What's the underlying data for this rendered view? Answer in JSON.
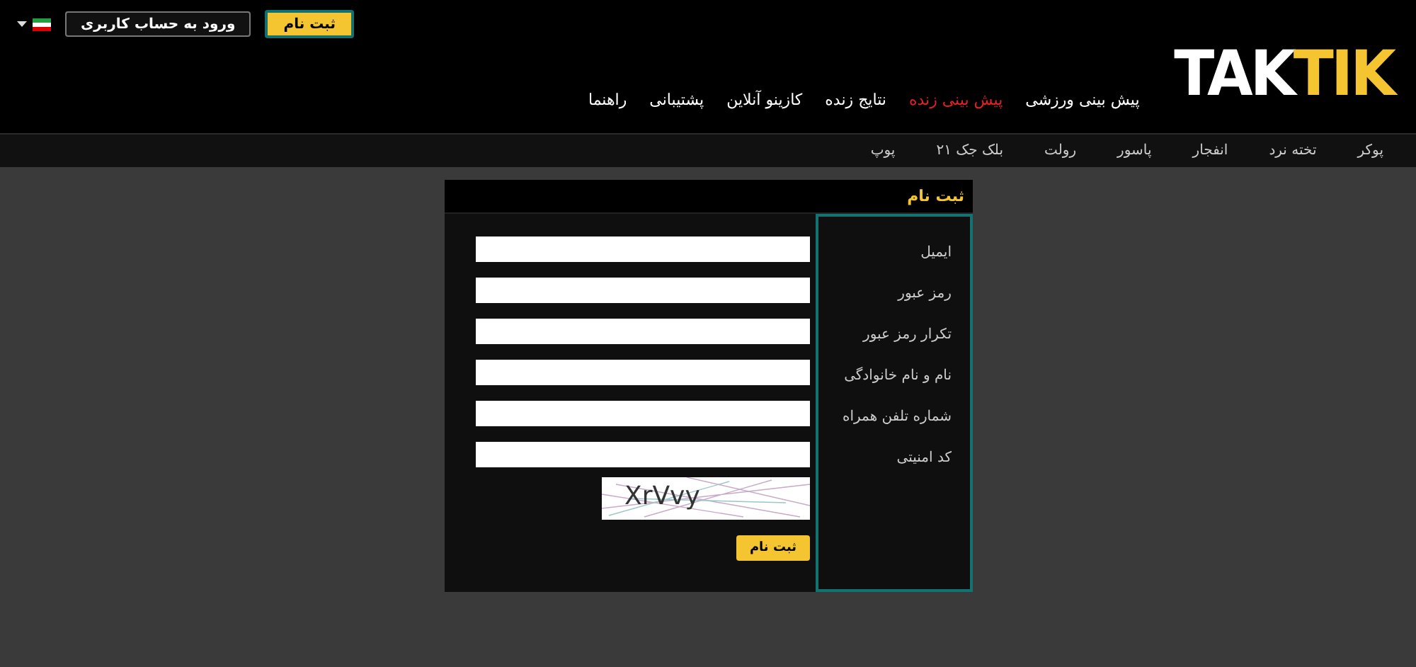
{
  "header": {
    "register_button": "ثبت نام",
    "login_button": "ورود به حساب کاربری",
    "logo": {
      "text": "TAK",
      "accent_text": "TIK"
    }
  },
  "main_menu": [
    {
      "label": "پیش بینی ورزشی",
      "selected": false
    },
    {
      "label": "پیش بینی زنده",
      "selected": true
    },
    {
      "label": "نتایج زنده",
      "selected": false
    },
    {
      "label": "کازینو آنلاین",
      "selected": false
    },
    {
      "label": "پشتیبانی",
      "selected": false
    },
    {
      "label": "راهنما",
      "selected": false
    }
  ],
  "sub_menu": [
    "پوکر",
    "تخته نرد",
    "انفجار",
    "پاسور",
    "رولت",
    "بلک جک ۲۱",
    "پوپ"
  ],
  "form": {
    "title": "ثبت نام",
    "fields": [
      {
        "label": "ایمیل",
        "kind": "text"
      },
      {
        "label": "رمز عبور",
        "kind": "text"
      },
      {
        "label": "تکرار رمز عبور",
        "kind": "text"
      },
      {
        "label": "نام و نام خانوادگی",
        "kind": "text"
      },
      {
        "label": "شماره تلفن همراه",
        "kind": "text"
      },
      {
        "label": "کد امنیتی",
        "kind": "captcha",
        "captcha": "XrVvy"
      }
    ],
    "submit": "ثبت نام"
  }
}
